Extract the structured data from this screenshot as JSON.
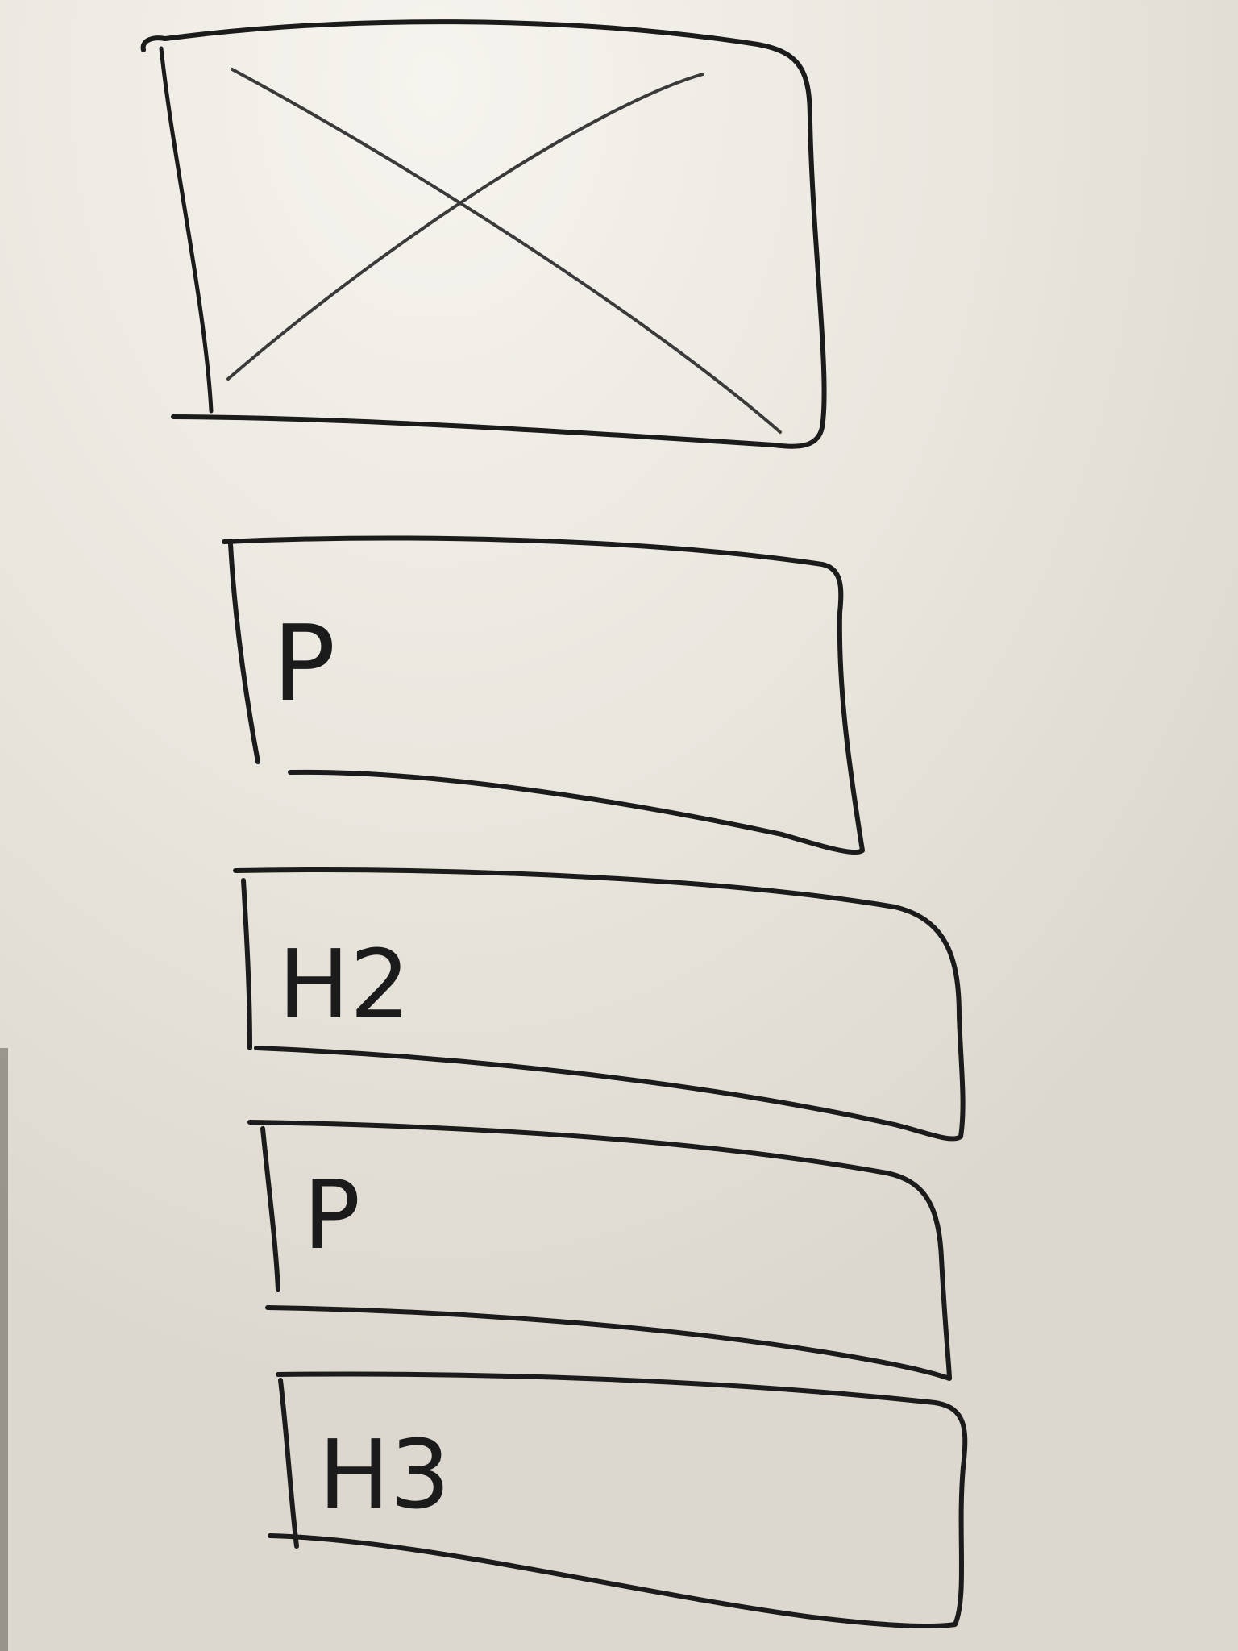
{
  "colors": {
    "board_background": "#e7e4dc",
    "board_highlight": "#f4f2ec",
    "marker_ink": "#1b1b1b",
    "marker_ink_light": "#5a5a5a"
  },
  "wireframe": {
    "image_placeholder": {
      "icon": "image-placeholder-x-icon"
    },
    "blocks": [
      {
        "label": "P"
      },
      {
        "label": "H2"
      },
      {
        "label": "P"
      },
      {
        "label": "H3"
      }
    ]
  }
}
